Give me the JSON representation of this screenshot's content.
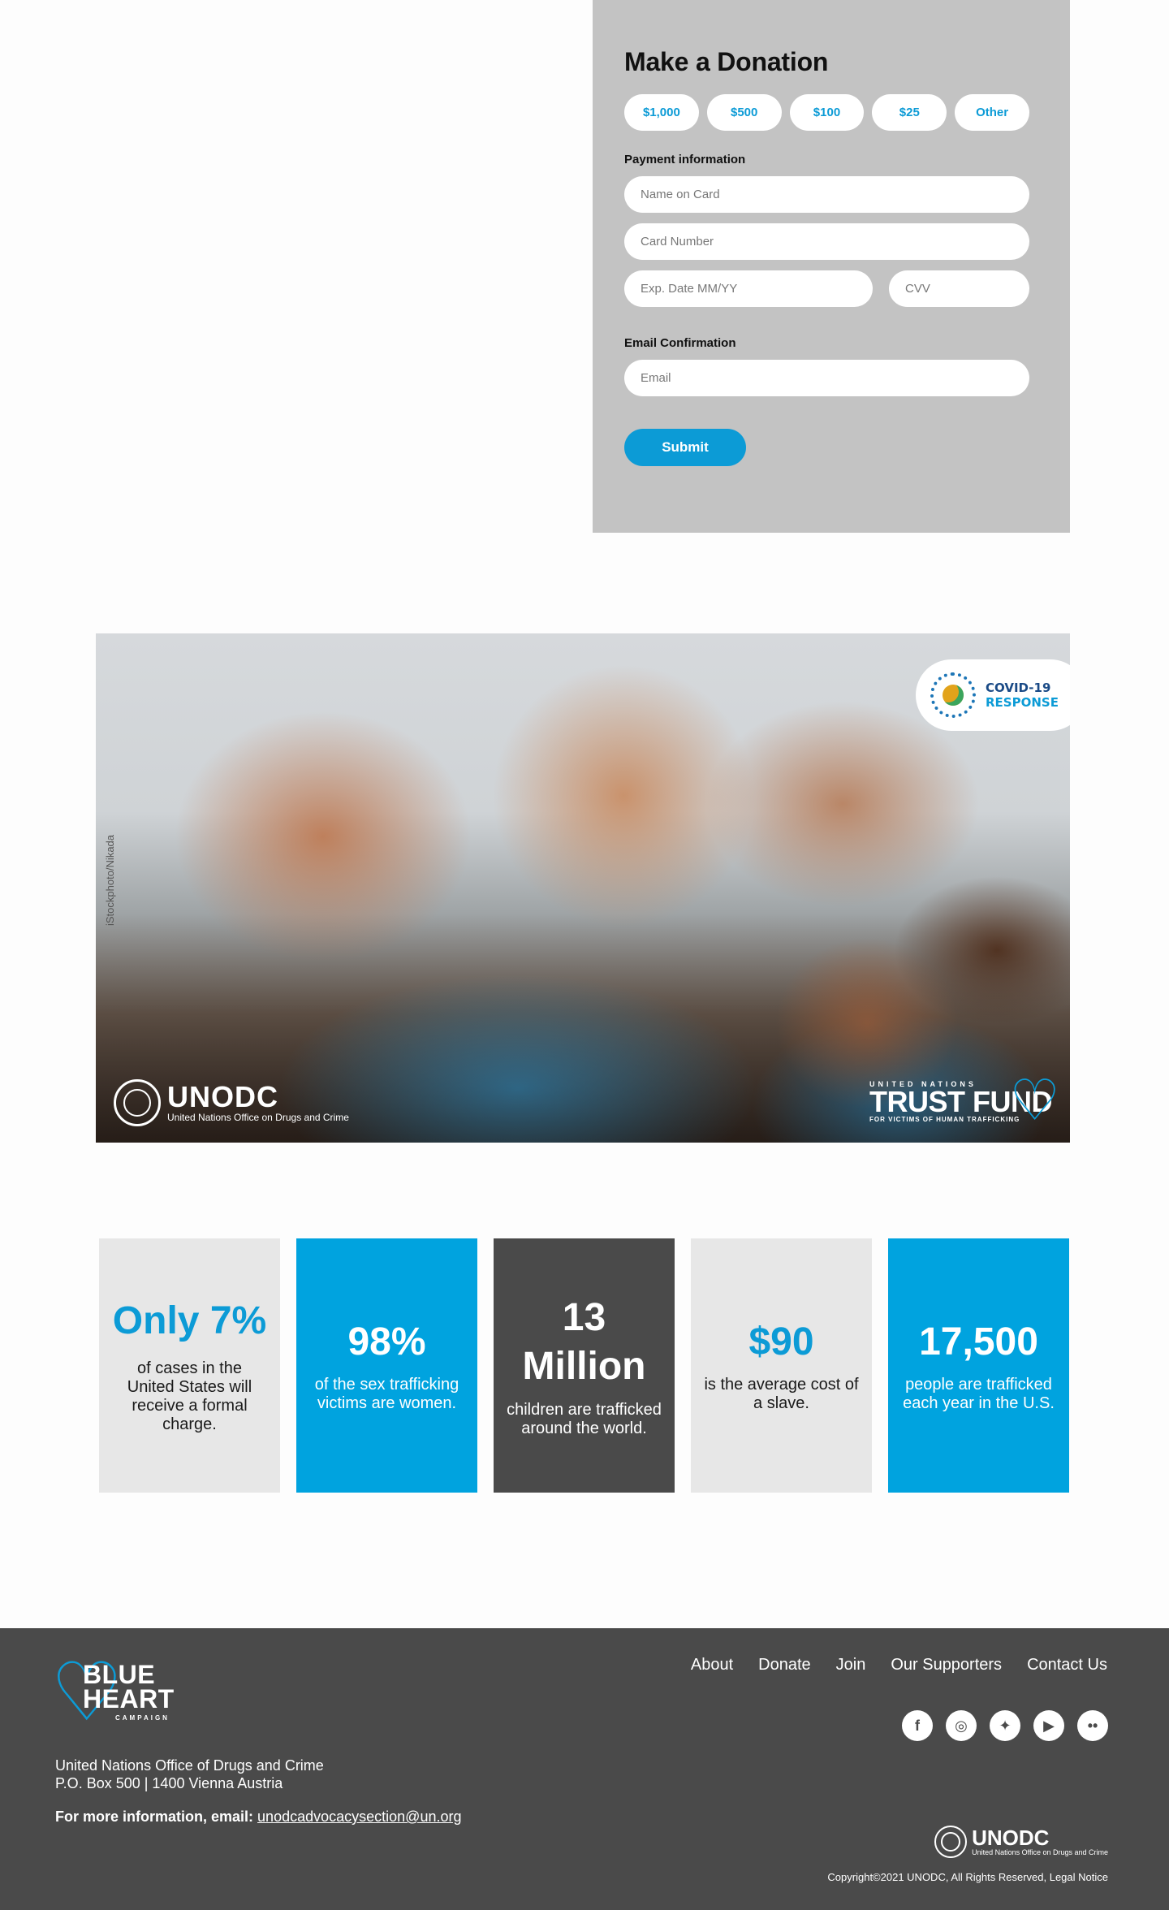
{
  "donation": {
    "title": "Make a Donation",
    "amounts": [
      "$1,000",
      "$500",
      "$100",
      "$25",
      "Other"
    ],
    "payment_label": "Payment information",
    "name_placeholder": "Name on Card",
    "card_placeholder": "Card Number",
    "exp_placeholder": "Exp. Date MM/YY",
    "cvv_placeholder": "CVV",
    "email_label": "Email Confirmation",
    "email_placeholder": "Email",
    "submit_label": "Submit"
  },
  "hero": {
    "photo_credit": "iStockphoto/Nikada",
    "covid_badge_line1": "COVID-19",
    "covid_badge_line2": "RESPONSE",
    "unodc_name": "UNODC",
    "unodc_subtitle": "United Nations Office on Drugs and Crime",
    "trust_fund_top": "UNITED NATIONS",
    "trust_fund_name": "TRUST FUND",
    "trust_fund_sub": "FOR VICTIMS OF HUMAN TRAFFICKING"
  },
  "stats": [
    {
      "big": "Only 7%",
      "desc": "of cases in the United States will receive a formal charge."
    },
    {
      "big": "98%",
      "desc": "of the sex trafficking victims are women."
    },
    {
      "big": "13 Million",
      "desc": "children are trafficked around the world."
    },
    {
      "big": "$90",
      "desc": "is the average cost of a slave."
    },
    {
      "big": "17,500",
      "desc": "people are trafficked each year in the U.S."
    }
  ],
  "footer": {
    "logo_text_line1": "BLUE",
    "logo_text_line2": "HEART",
    "logo_sub": "CAMPAIGN",
    "address_line1": "United Nations Office of Drugs and Crime",
    "address_line2": "P.O. Box 500  |  1400 Vienna Austria",
    "more_info_label": "For more information, email:",
    "email": "unodcadvocacysection@un.org",
    "nav": [
      "About",
      "Donate",
      "Join",
      "Our Supporters",
      "Contact Us"
    ],
    "social_icons": [
      "facebook-icon",
      "instagram-icon",
      "twitter-icon",
      "youtube-icon",
      "flickr-icon"
    ],
    "unodc_name": "UNODC",
    "unodc_subtitle": "United Nations Office on Drugs and Crime",
    "copyright": "Copyright©2021 UNODC, All Rights Reserved, Legal Notice"
  },
  "colors": {
    "accent": "#00a3df",
    "panel_gray": "#c3c3c3",
    "footer_bg": "#4a4a4a",
    "stat_light": "#e7e7e7"
  }
}
